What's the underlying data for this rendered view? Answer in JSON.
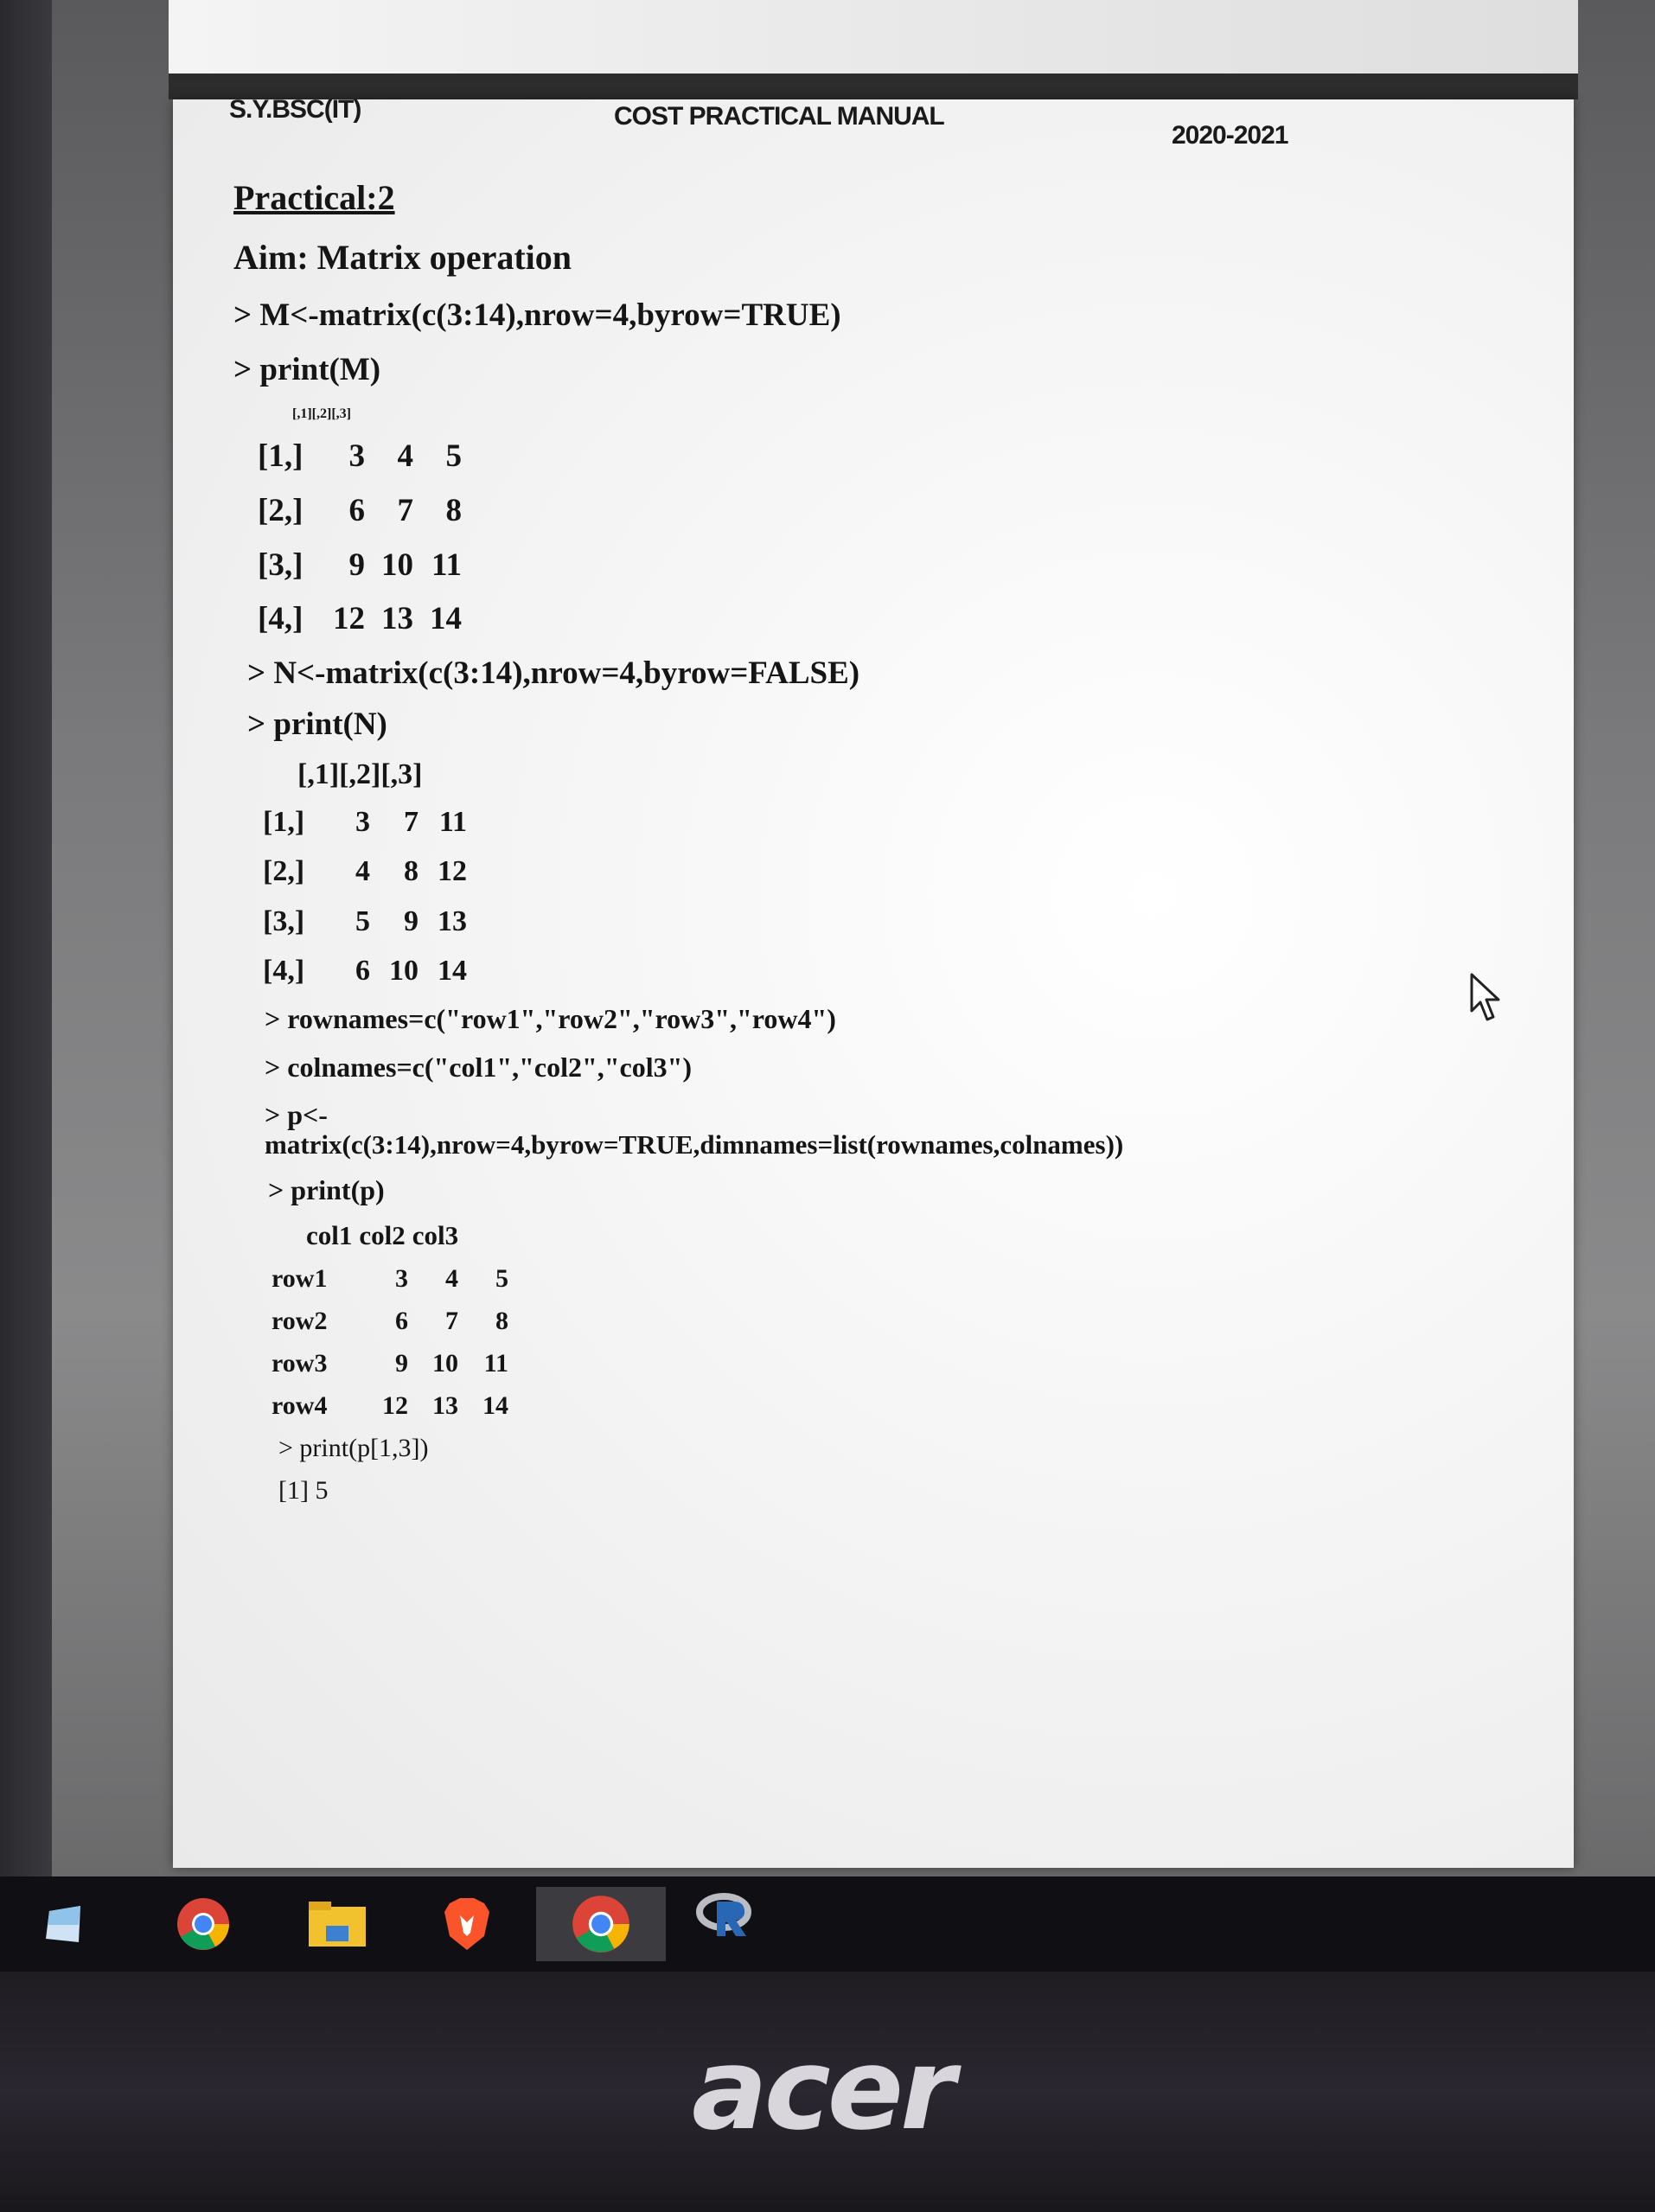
{
  "header": {
    "left": "S.Y.BSC(IT)",
    "center": "COST PRACTICAL MANUAL",
    "right": "2020-2021"
  },
  "doc": {
    "practical": "Practical:2",
    "aim": "Aim: Matrix operation",
    "lines": [
      "> M<-matrix(c(3:14),nrow=4,byrow=TRUE)",
      "> print(M)",
      "> N<-matrix(c(3:14),nrow=4,byrow=FALSE)",
      "> print(N)",
      "> rownames=c(\"row1\",\"row2\",\"row3\",\"row4\")",
      "> colnames=c(\"col1\",\"col2\",\"col3\")",
      "> p<-",
      "matrix(c(3:14),nrow=4,byrow=TRUE,dimnames=list(rownames,colnames))",
      "> print(p)",
      "> print(p[1,3])",
      "[1] 5"
    ],
    "matrix_m": {
      "header": [
        "[,1]",
        "[,2]",
        "[,3]"
      ],
      "rows": [
        {
          "label": "[1,]",
          "cells": [
            "3",
            "4",
            "5"
          ]
        },
        {
          "label": "[2,]",
          "cells": [
            "6",
            "7",
            "8"
          ]
        },
        {
          "label": "[3,]",
          "cells": [
            "9",
            "10",
            "11"
          ]
        },
        {
          "label": "[4,]",
          "cells": [
            "12",
            "13",
            "14"
          ]
        }
      ]
    },
    "matrix_n": {
      "header": [
        "[,1]",
        "[,2]",
        "[,3]"
      ],
      "rows": [
        {
          "label": "[1,]",
          "cells": [
            "3",
            "7",
            "11"
          ]
        },
        {
          "label": "[2,]",
          "cells": [
            "4",
            "8",
            "12"
          ]
        },
        {
          "label": "[3,]",
          "cells": [
            "5",
            "9",
            "13"
          ]
        },
        {
          "label": "[4,]",
          "cells": [
            "6",
            "10",
            "14"
          ]
        }
      ]
    },
    "matrix_p": {
      "header": [
        "col1",
        "col2",
        "col3"
      ],
      "rows": [
        {
          "label": "row1",
          "cells": [
            "3",
            "4",
            "5"
          ]
        },
        {
          "label": "row2",
          "cells": [
            "6",
            "7",
            "8"
          ]
        },
        {
          "label": "row3",
          "cells": [
            "9",
            "10",
            "11"
          ]
        },
        {
          "label": "row4",
          "cells": [
            "12",
            "13",
            "14"
          ]
        }
      ]
    }
  },
  "taskbar": {
    "items": [
      {
        "name": "task-view-icon",
        "color": "#5aa8e6"
      },
      {
        "name": "chrome-icon",
        "color": "#db4437"
      },
      {
        "name": "file-explorer-icon",
        "color": "#f2c12e"
      },
      {
        "name": "brave-icon",
        "color": "#fb542b"
      },
      {
        "name": "chrome-icon",
        "color": "#db4437"
      },
      {
        "name": "r-icon",
        "color": "#2767b4"
      }
    ]
  },
  "bezel": {
    "brand": "acer"
  }
}
